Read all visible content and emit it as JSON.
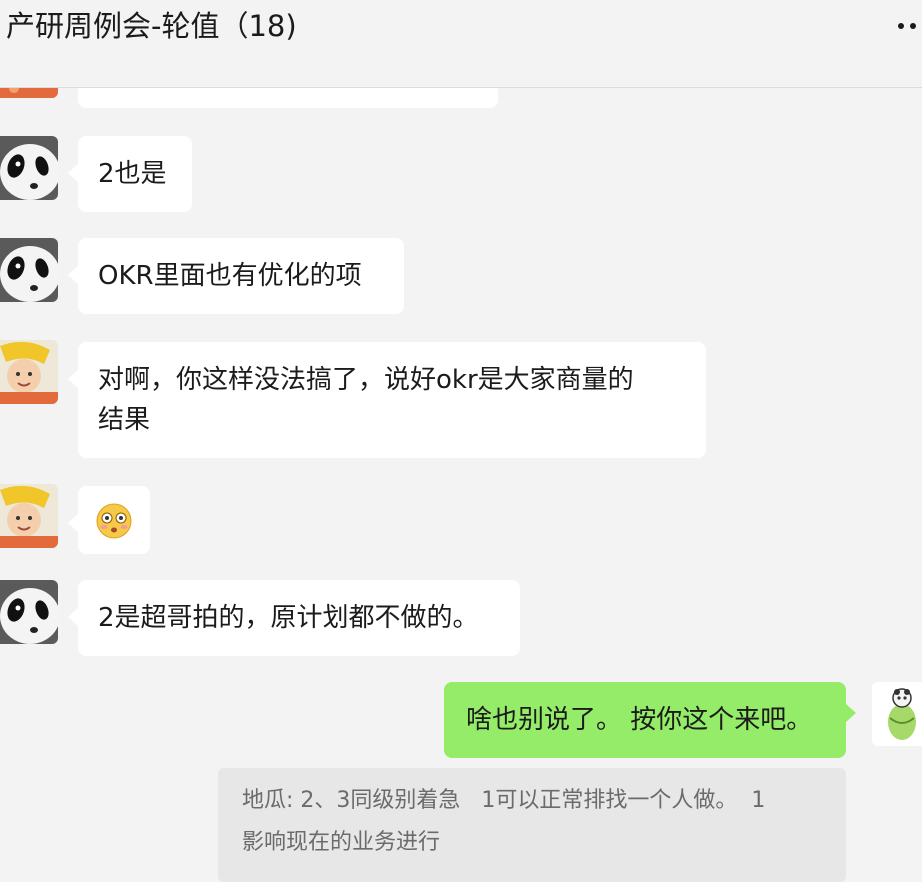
{
  "header": {
    "title": "产研周例会-轮值（18)"
  },
  "messages": [
    {
      "text": "2也是"
    },
    {
      "text": "OKR里面也有优化的项"
    },
    {
      "text_line1": "对啊，你这样没法搞了，说好okr是大家商量的",
      "text_line2": "结果"
    },
    {
      "emoji": "blush-emoji"
    },
    {
      "text": "2是超哥拍的，原计划都不做的。"
    },
    {
      "text": "啥也别说了。 按你这个来吧。"
    }
  ],
  "quote": {
    "line1": "地瓜: 2、3同级别着急   1可以正常排找一个人做。  1",
    "line2": "影响现在的业务进行"
  },
  "colors": {
    "background": "#f3f3f3",
    "incoming_bubble": "#ffffff",
    "outgoing_bubble": "#95ec69",
    "quote_bg": "#e7e7e7"
  }
}
